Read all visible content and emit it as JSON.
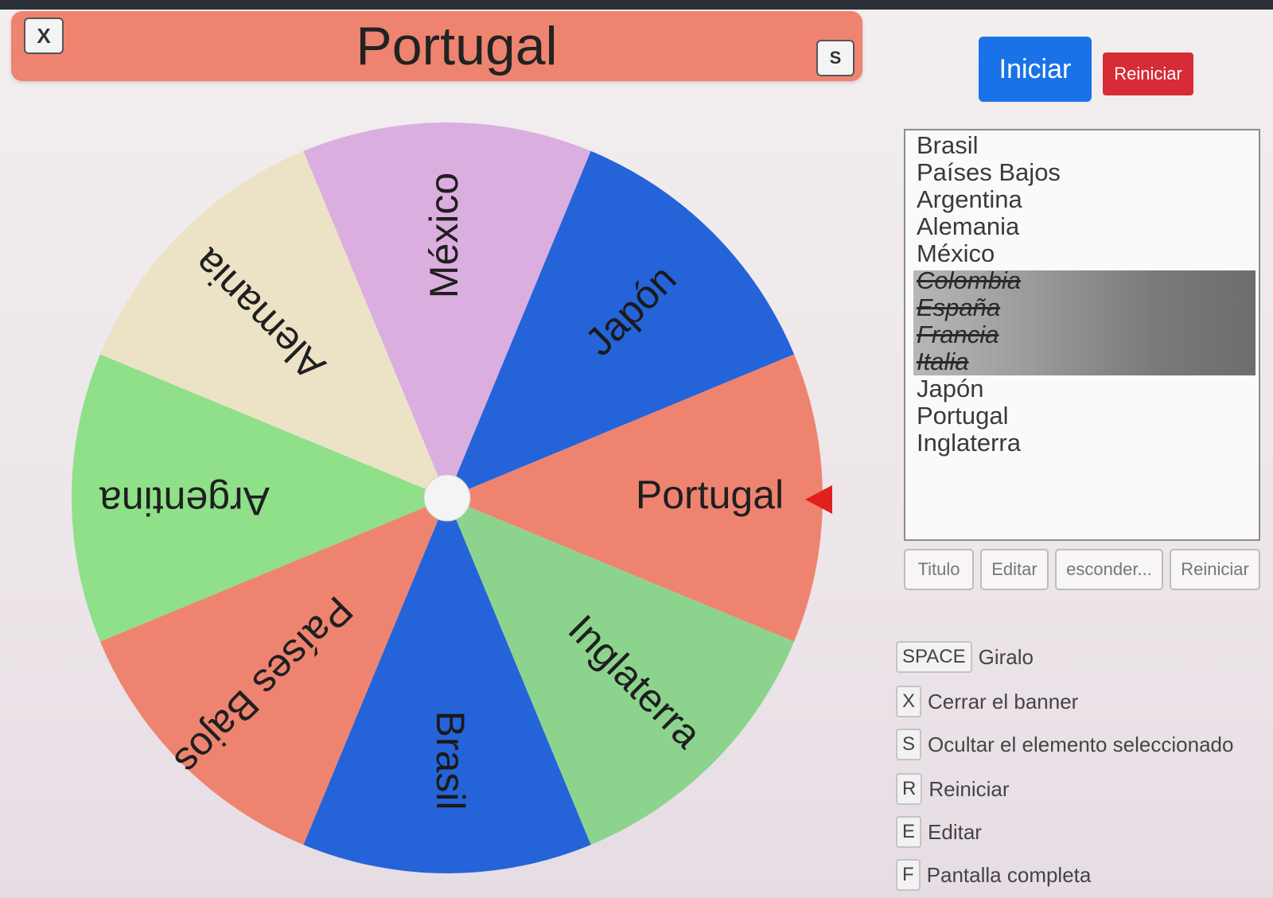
{
  "banner": {
    "close_key": "X",
    "title": "Portugal",
    "hide_key": "S"
  },
  "actions": {
    "start_label": "Iniciar",
    "reset_label": "Reiniciar"
  },
  "wheel": {
    "selected": "Portugal",
    "segments": [
      {
        "label": "Portugal",
        "color": "#ee8470"
      },
      {
        "label": "Inglaterra",
        "color": "#8cd48e"
      },
      {
        "label": "Brasil",
        "color": "#2563d9"
      },
      {
        "label": "Países Bajos",
        "color": "#ee8470"
      },
      {
        "label": "Argentina",
        "color": "#8fe089"
      },
      {
        "label": "Alemania",
        "color": "#ece3c6"
      },
      {
        "label": "México",
        "color": "#dbaee0"
      },
      {
        "label": "Japón",
        "color": "#2563d9"
      }
    ],
    "pointer_color": "#e0201c",
    "hub_color": "#f4f4f4"
  },
  "entries": [
    {
      "label": "Brasil",
      "done": false
    },
    {
      "label": "Países Bajos",
      "done": false
    },
    {
      "label": "Argentina",
      "done": false
    },
    {
      "label": "Alemania",
      "done": false
    },
    {
      "label": "México",
      "done": false
    },
    {
      "label": "Colombia",
      "done": true
    },
    {
      "label": "España",
      "done": true
    },
    {
      "label": "Francia",
      "done": true
    },
    {
      "label": "Italia",
      "done": true
    },
    {
      "label": "Japón",
      "done": false
    },
    {
      "label": "Portugal",
      "done": false
    },
    {
      "label": "Inglaterra",
      "done": false
    }
  ],
  "toolbar": {
    "title_label": "Titulo",
    "edit_label": "Editar",
    "hide_label": "esconder...",
    "reset_label": "Reiniciar"
  },
  "shortcuts": [
    {
      "key": "SPACE",
      "label": "Giralo"
    },
    {
      "key": "X",
      "label": "Cerrar el banner"
    },
    {
      "key": "S",
      "label": "Ocultar el elemento seleccionado"
    },
    {
      "key": "R",
      "label": "Reiniciar"
    },
    {
      "key": "E",
      "label": "Editar"
    },
    {
      "key": "F",
      "label": "Pantalla completa"
    }
  ]
}
